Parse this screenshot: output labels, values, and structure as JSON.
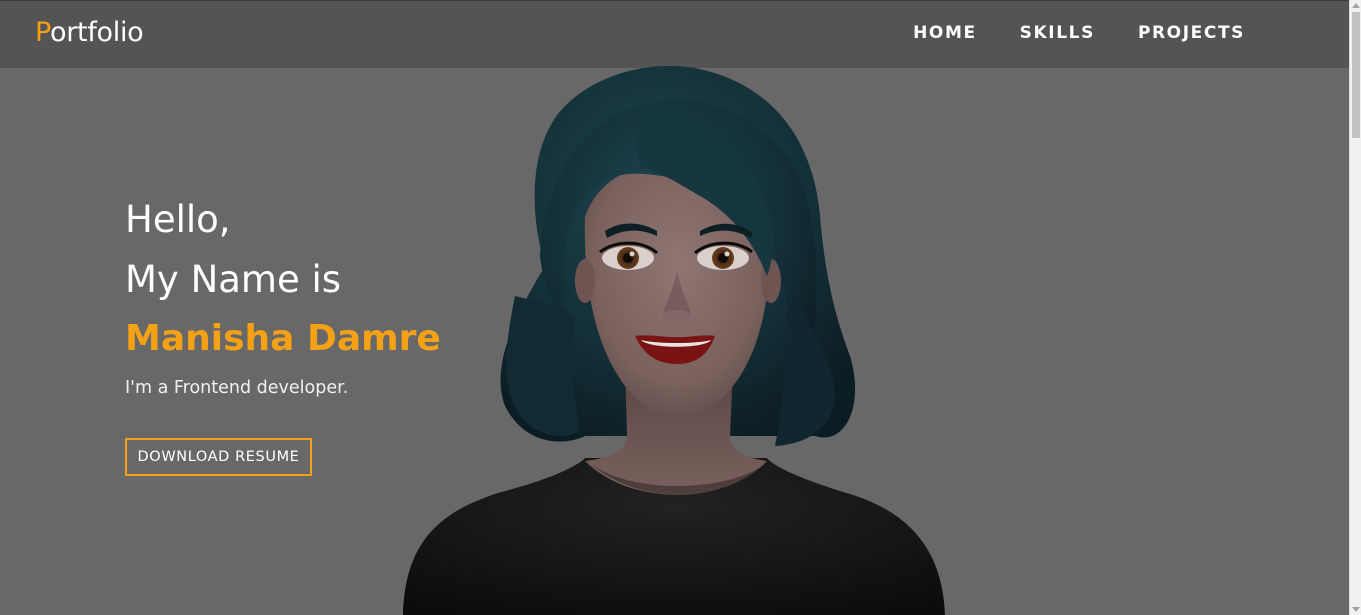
{
  "header": {
    "brand_initial": "P",
    "brand_rest": "ortfolio",
    "nav": [
      {
        "label": "HOME"
      },
      {
        "label": "SKILLS"
      },
      {
        "label": "PROJECTS"
      }
    ]
  },
  "hero": {
    "greeting": "Hello,",
    "intro": "My Name is",
    "name": "Manisha Damre",
    "tagline": "I'm a Frontend developer.",
    "button_label": "DOWNLOAD RESUME"
  },
  "colors": {
    "accent": "#f5a116",
    "background": "#686868",
    "navbar": "#545454"
  }
}
